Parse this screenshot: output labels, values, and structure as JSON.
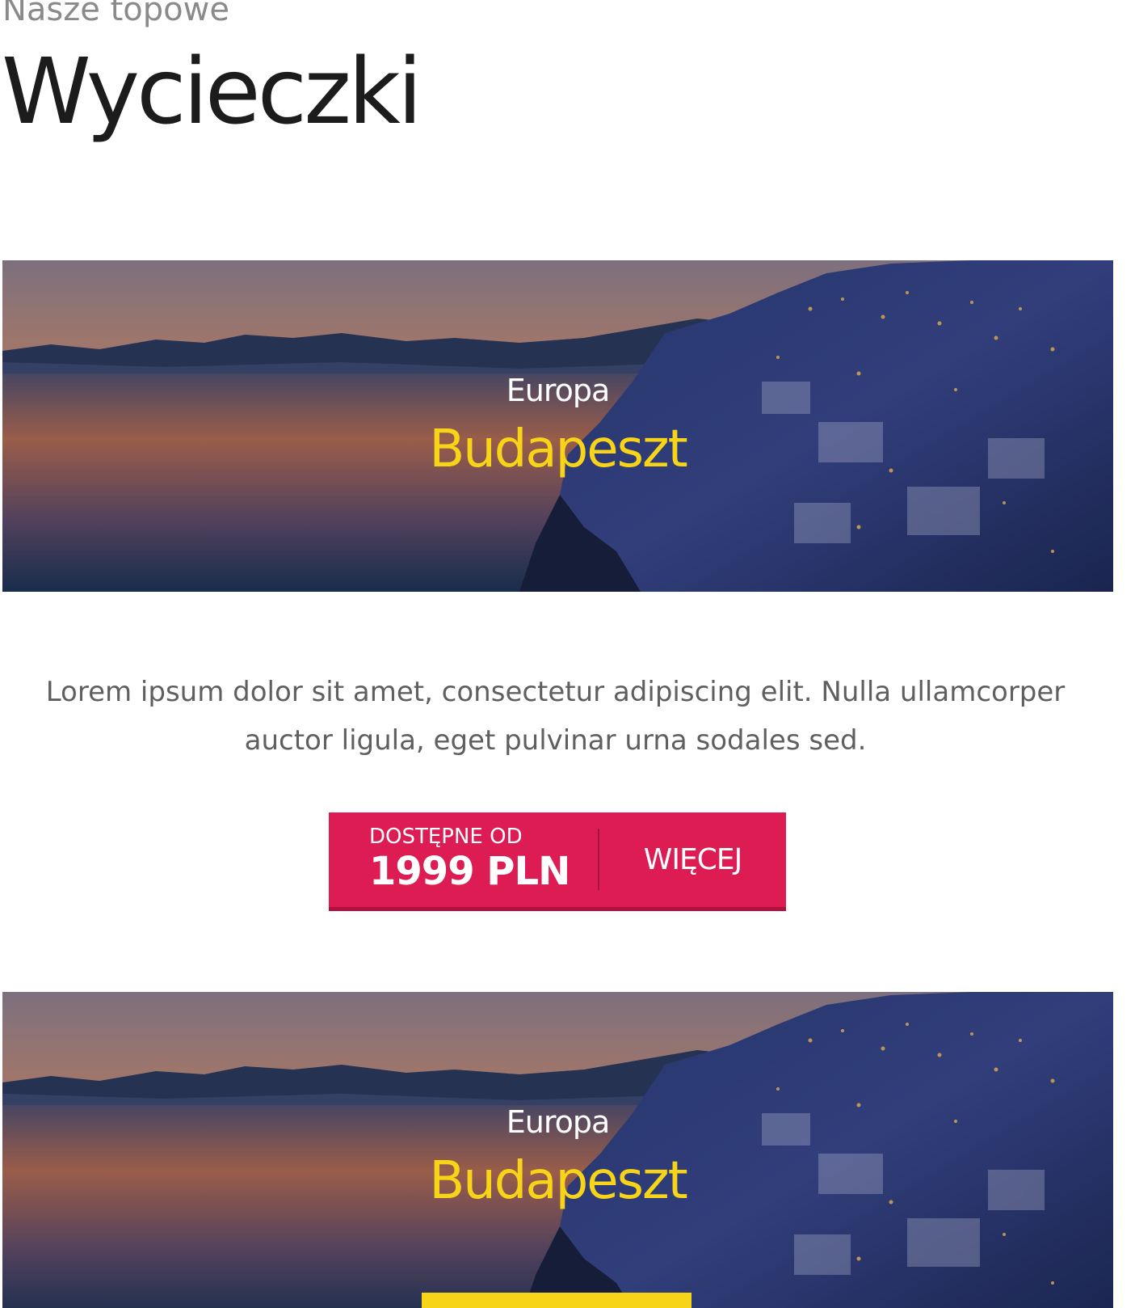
{
  "heading": {
    "subtitle": "Nasze topowe",
    "title": "Wycieczki"
  },
  "tours": [
    {
      "region": "Europa",
      "city": "Budapeszt",
      "description_line1": "Lorem ipsum dolor sit amet, consectetur adipiscing elit. Nulla ullamcorper",
      "description_line2": "auctor ligula, eget pulvinar urna sodales sed.",
      "cta": {
        "available_label": "DOSTĘPNE OD",
        "price": "1999 PLN",
        "more_label": "WIĘCEJ"
      }
    },
    {
      "region": "Europa",
      "city": "Budapeszt"
    }
  ],
  "colors": {
    "accent_red": "#dd1c53",
    "accent_yellow": "#f7d417",
    "heading_dark": "#1c1c1c",
    "subheading_gray": "#8a8a8a",
    "body_gray": "#5f5f5f"
  }
}
